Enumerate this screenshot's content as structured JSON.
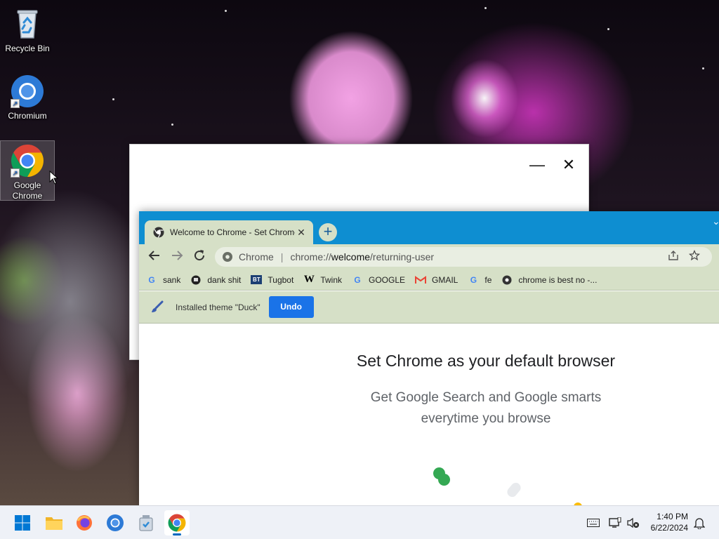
{
  "desktop": {
    "icons": [
      {
        "label": "Recycle Bin",
        "icon": "recycle-bin-icon"
      },
      {
        "label": "Chromium",
        "icon": "chromium-icon"
      },
      {
        "label": "Google Chrome",
        "icon": "chrome-icon"
      }
    ]
  },
  "back_window": {
    "minimize": "—",
    "close": "✕"
  },
  "chrome": {
    "tab": {
      "title": "Welcome to Chrome - Set Chrome as your default browser",
      "close": "✕"
    },
    "new_tab": "+",
    "omnibox": {
      "site_label": "Chrome",
      "url_prefix": "chrome://",
      "url_host": "welcome",
      "url_path": "/returning-user"
    },
    "bookmarks": [
      {
        "label": "sank",
        "icon": "google-g-icon"
      },
      {
        "label": "dank shit",
        "icon": "dank-favicon-icon"
      },
      {
        "label": "Tugbot",
        "icon": "bt-favicon-icon"
      },
      {
        "label": "Twink",
        "icon": "wikipedia-w-icon"
      },
      {
        "label": "GOOGLE",
        "icon": "google-g-icon"
      },
      {
        "label": "GMAIL",
        "icon": "gmail-icon"
      },
      {
        "label": "fe",
        "icon": "google-g-icon"
      },
      {
        "label": "chrome is best no -...",
        "icon": "globe-icon"
      }
    ],
    "infobar": {
      "message": "Installed theme \"Duck\"",
      "undo": "Undo"
    },
    "content": {
      "headline": "Set Chrome as your default browser",
      "subline_1": "Get Google Search and Google smarts",
      "subline_2": "everytime you browse"
    },
    "colors": {
      "tabstrip": "#0e8ed1",
      "toolbar": "#d6e0c7",
      "undo_button": "#1a73e8"
    }
  },
  "taskbar": {
    "apps": [
      "start-icon",
      "file-explorer-icon",
      "firefox-icon",
      "chromium-icon",
      "unknown-app-icon",
      "chrome-icon"
    ],
    "clock": {
      "time": "1:40 PM",
      "date": "6/22/2024"
    }
  }
}
